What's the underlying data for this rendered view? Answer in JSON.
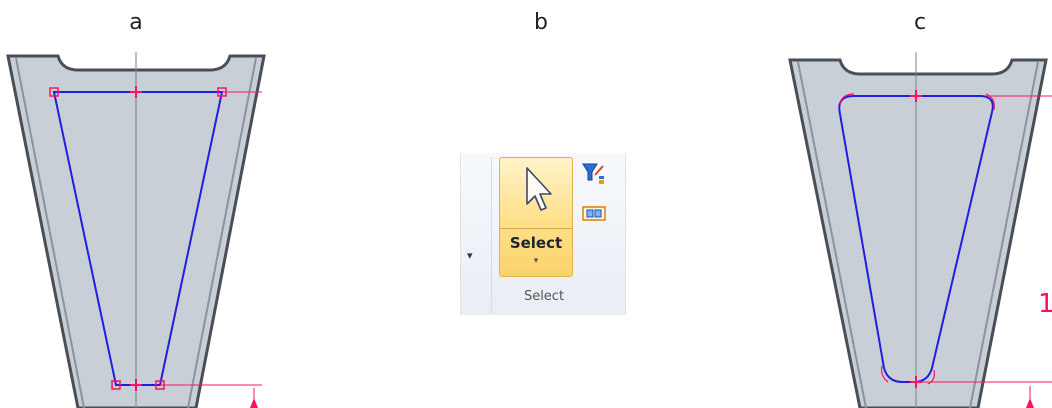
{
  "panel_labels": [
    "a",
    "b",
    "c"
  ],
  "ribbon": {
    "collapse_glyph": "▾",
    "select_button_label": "Select",
    "select_dropdown_glyph": "▾",
    "group_label": "Select",
    "icons": [
      "arrow-cursor-icon",
      "filter-icon",
      "box-select-icon"
    ],
    "accent_color": "#ffe08a"
  },
  "sketch": {
    "dimension_text_c": "1",
    "sketch_color": "#1f1fe0",
    "constraint_color": "#ff1060"
  }
}
